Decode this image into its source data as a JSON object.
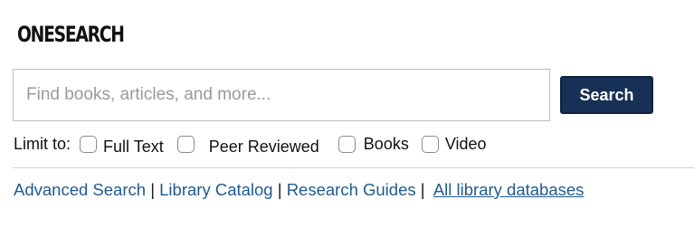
{
  "header": {
    "title": "ONESEARCH"
  },
  "search": {
    "placeholder": "Find books, articles, and more...",
    "value": "",
    "button_label": "Search"
  },
  "limits": {
    "label": "Limit to:",
    "options": [
      {
        "label": "Full Text",
        "checked": false
      },
      {
        "label": "Peer Reviewed",
        "checked": false
      },
      {
        "label": "Books",
        "checked": false
      },
      {
        "label": "Video",
        "checked": false
      }
    ]
  },
  "links": {
    "items": [
      {
        "label": "Advanced Search"
      },
      {
        "label": "Library Catalog"
      },
      {
        "label": "Research Guides"
      },
      {
        "label": "All library databases"
      }
    ],
    "separator": "|"
  },
  "colors": {
    "button_bg": "#173056",
    "link": "#1f5a8f",
    "text": "#111111"
  }
}
